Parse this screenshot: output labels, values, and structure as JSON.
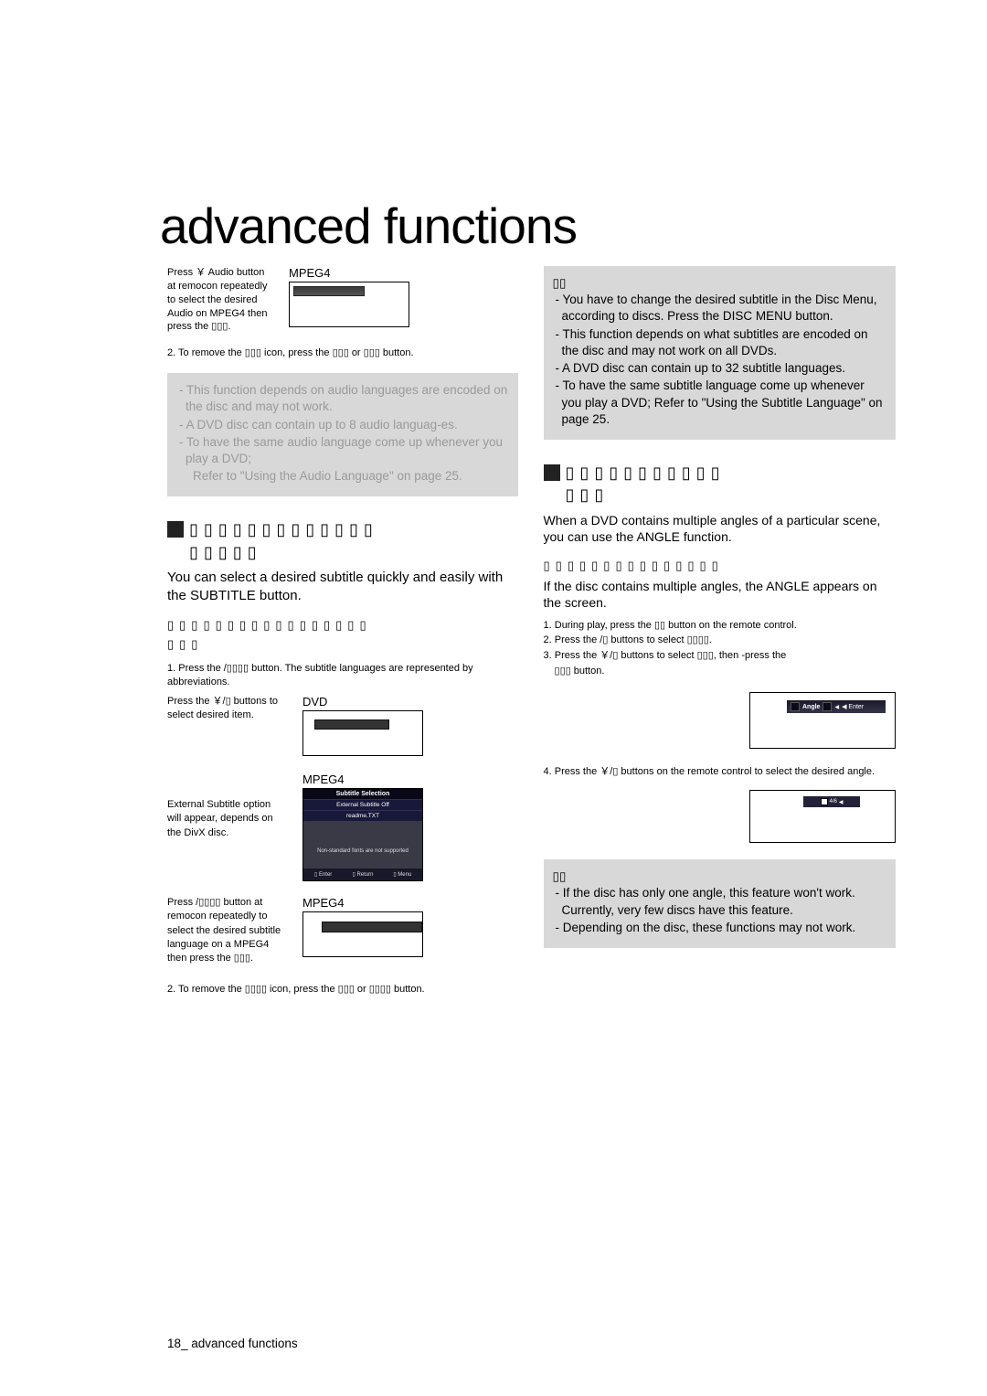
{
  "title": "advanced functions",
  "left": {
    "audio_mpeg4": {
      "side": "Press ￥ Audio button at remocon repeatedly to select the desired Audio on MPEG4 then press the ▯▯▯.",
      "label": "MPEG4"
    },
    "audio_remove": "2. To remove the ▯▯▯ icon, press the ▯▯▯ or ▯▯▯ button.",
    "audio_note": {
      "l1": "- This function depends on audio languages are encoded on the disc and may not work.",
      "l2": "- A DVD disc can contain up to 8 audio languag-es.",
      "l3": "- To have the same audio language come up whenever you play a DVD;",
      "l4": "Refer to \"Using the Audio Language\" on page 25."
    },
    "sub_head_line1": "▯▯▯▯▯▯▯▯▯▯▯▯▯",
    "sub_head_line2": "▯▯▯▯▯",
    "sub_lead": "You can select a desired subtitle quickly and easily with the SUBTITLE button.",
    "sub_using_l1": "▯▯▯▯▯▯▯▯▯▯▯▯▯▯▯▯▯",
    "sub_using_l2": "▯▯▯",
    "sub_step1a": "1. Press the  /▯▯▯▯ button. The subtitle languages are represented by abbreviations.",
    "sub_step1b": "Press the ￥/▯ buttons to select desired item.",
    "dvd_label": "DVD",
    "divx_side": "External Subtitle option will appear, depends on the DivX disc.",
    "mpeg4_label": "MPEG4",
    "osd": {
      "t": "Subtitle Selection",
      "a": "External Subtitle Off",
      "b": "readme.TXT",
      "w": "Non-standard fonts are not supported",
      "b1": "▯ Enter",
      "b2": "▯ Return",
      "b3": "▯ Menu"
    },
    "sub_mpeg4_side": "Press  /▯▯▯▯ button at remocon repeatedly to select the desired subtitle language on a MPEG4 then press the ▯▯▯.",
    "mpeg4_label2": "MPEG4",
    "sub_remove": "2. To remove the ▯▯▯▯ icon, press the ▯▯▯ or ▯▯▯▯ button."
  },
  "right": {
    "note1": {
      "h": "▯▯",
      "l1": "- You have to change the desired subtitle in the Disc Menu, according to discs. Press the DISC MENU button.",
      "l2": "- This function depends on what subtitles are encoded on the disc and may not work on all DVDs.",
      "l3": "- A DVD disc can contain up to 32 subtitle languages.",
      "l4": "- To have the same subtitle language come up whenever you play a DVD; Refer to \"Using the Subtitle Language\" on page 25."
    },
    "ang_head_l1": "▯▯▯▯▯▯▯▯▯▯▯",
    "ang_head_l2": "▯▯▯",
    "ang_lead": "When a DVD contains multiple angles of a particular scene, you can use the ANGLE function.",
    "ang_using": "▯▯▯▯▯▯▯▯▯▯▯▯▯▯▯",
    "ang_cond": "If the disc contains multiple angles, the ANGLE appears on the screen.",
    "s1": "1. During play, press the ▯▯ button on the remote control.",
    "s2": "2. Press the  /▯ buttons to select ▯▯▯▯.",
    "s3a": "3. Press the ￥/▯ buttons to select ▯▯▯, then -press the",
    "s3b": "▯▯▯ button.",
    "strip_angle": "Angle",
    "strip_enter": "◀ Enter",
    "s4": "4. Press the ￥/▯ buttons on the remote control to select the desired angle.",
    "note2": {
      "h": "▯▯",
      "l1": "- If the disc has only one angle, this feature won't work. Currently, very few discs have this feature.",
      "l2": "- Depending on the disc, these functions may not work."
    }
  },
  "footer": "18_ advanced functions"
}
